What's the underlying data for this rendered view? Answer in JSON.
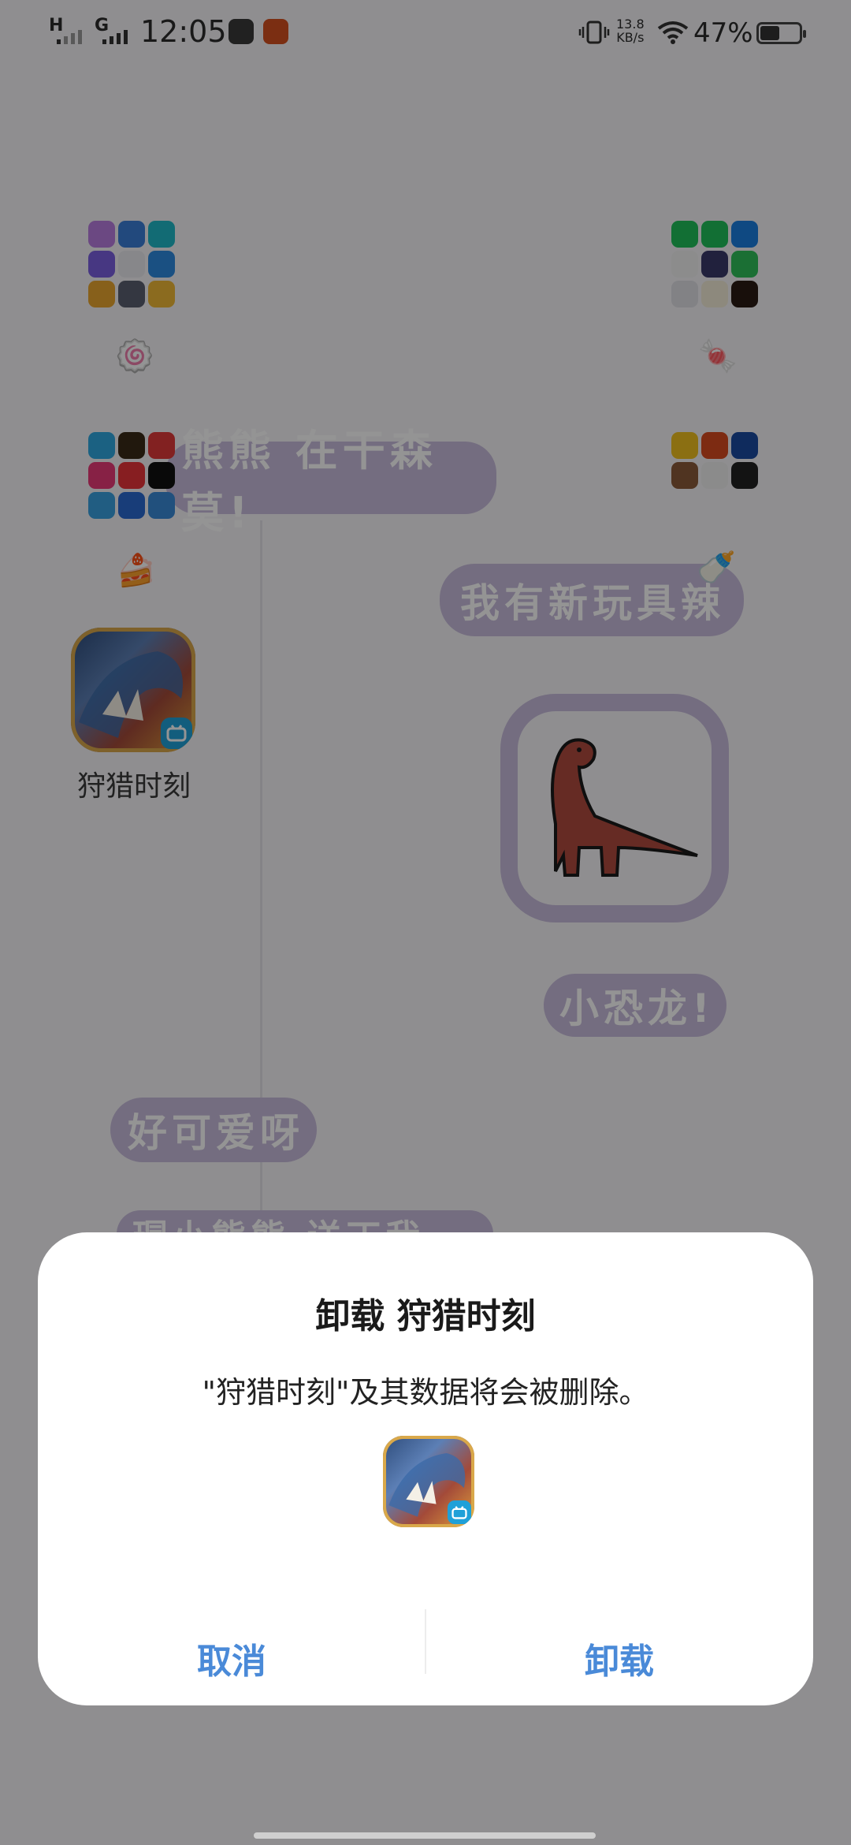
{
  "status_bar": {
    "time": "12:05",
    "sim1_label": "H",
    "sim2_label": "G",
    "net_speed_value": "13.8",
    "net_speed_unit": "KB/s",
    "battery_percent": "47%",
    "battery_level": 0.47
  },
  "wallpaper": {
    "bubble_1": "熊熊 在干森莫!",
    "bubble_2": "我有新玩具辣",
    "bubble_3": "小恐龙!",
    "bubble_4": "好可爱呀",
    "bubble_5": "瑁小熊熊 送丁我",
    "accent_color": "#c8bcdc"
  },
  "home": {
    "app_label": "狩猎时刻"
  },
  "dialog": {
    "title": "卸载 狩猎时刻",
    "message": "\"狩猎时刻\"及其数据将会被删除。",
    "cancel_label": "取消",
    "confirm_label": "卸载",
    "button_color": "#4a8ad8"
  }
}
